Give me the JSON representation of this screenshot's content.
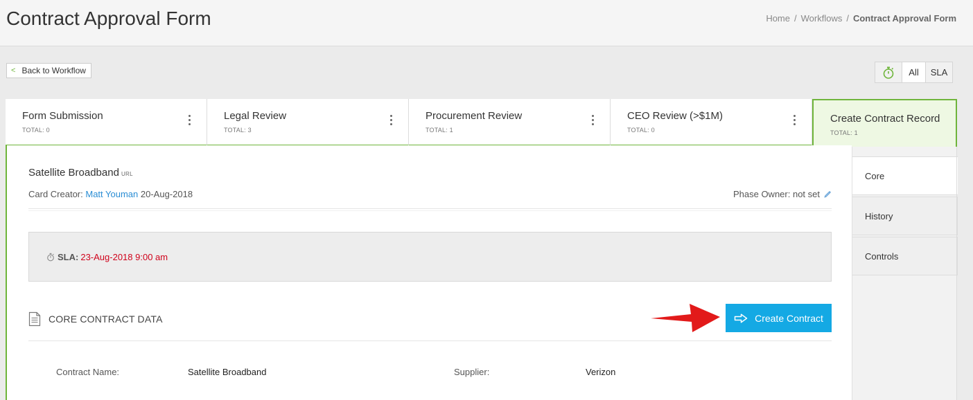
{
  "header": {
    "title": "Contract Approval Form",
    "breadcrumb": [
      "Home",
      "Workflows",
      "Contract Approval Form"
    ],
    "separator": "/"
  },
  "toolbar": {
    "back_label": "Back to Workflow",
    "filter_all": "All",
    "filter_sla": "SLA"
  },
  "phases": [
    {
      "name": "Form Submission",
      "total": "TOTAL: 0"
    },
    {
      "name": "Legal Review",
      "total": "TOTAL: 3"
    },
    {
      "name": "Procurement Review",
      "total": "TOTAL: 1"
    },
    {
      "name": "CEO Review (>$1M)",
      "total": "TOTAL: 0"
    },
    {
      "name": "Create Contract Record",
      "total": "TOTAL: 1"
    }
  ],
  "card": {
    "title": "Satellite Broadband",
    "url_tag": "URL",
    "creator_label": "Card Creator:",
    "creator_name": "Matt Youman",
    "created_date": "20-Aug-2018",
    "phase_owner_label": "Phase Owner:",
    "phase_owner_value": "not set",
    "sla_label": "SLA:",
    "sla_value": "23-Aug-2018 9:00 am",
    "section_title": "CORE CONTRACT DATA",
    "create_button": "Create Contract",
    "fields": {
      "contract_name_label": "Contract Name:",
      "contract_name_value": "Satellite Broadband",
      "supplier_label": "Supplier:",
      "supplier_value": "Verizon"
    }
  },
  "side_tabs": [
    "Core",
    "History",
    "Controls"
  ],
  "colors": {
    "accent_green": "#6fb53b",
    "button_blue": "#14a9e4",
    "link_blue": "#2a8dd4",
    "sla_red": "#d0021b",
    "annotation_red": "#e21a1a"
  }
}
